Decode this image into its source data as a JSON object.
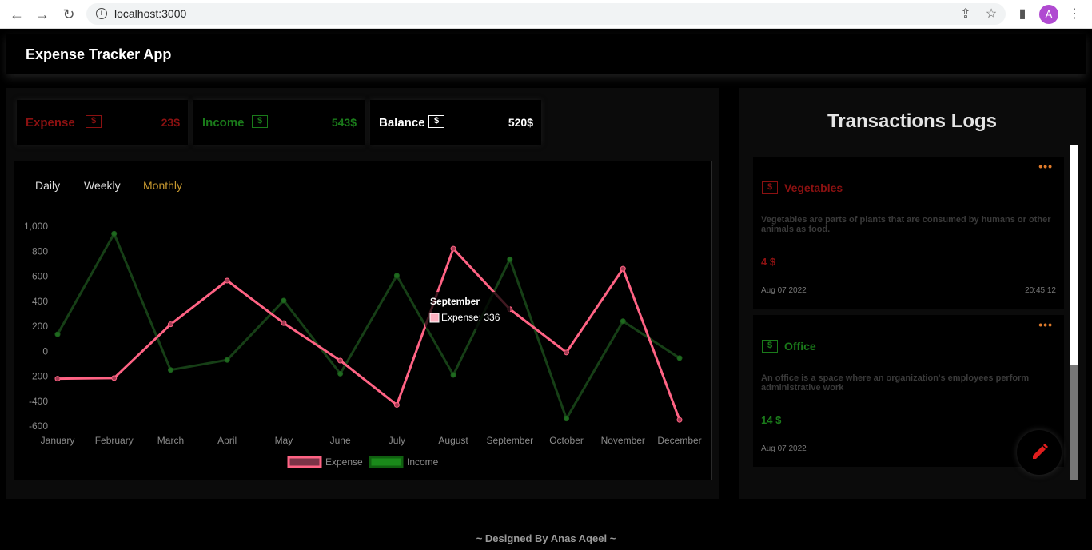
{
  "browser": {
    "url": "localhost:3000",
    "profile_initial": "A"
  },
  "app": {
    "title": "Expense Tracker App"
  },
  "stats": {
    "expense": {
      "label": "Expense",
      "value": "23$",
      "icon": "$"
    },
    "income": {
      "label": "Income",
      "value": "543$",
      "icon": "$"
    },
    "balance": {
      "label": "Balance",
      "value": "520$",
      "icon": "$"
    }
  },
  "tabs": {
    "daily": "Daily",
    "weekly": "Weekly",
    "monthly": "Monthly",
    "active": "monthly"
  },
  "chart_data": {
    "type": "line",
    "categories": [
      "January",
      "February",
      "March",
      "April",
      "May",
      "June",
      "July",
      "August",
      "September",
      "October",
      "November",
      "December"
    ],
    "series": [
      {
        "name": "Expense",
        "color": "#ff6384",
        "values": [
          -220,
          -215,
          215,
          565,
          225,
          -75,
          -430,
          820,
          336,
          -10,
          660,
          -550
        ]
      },
      {
        "name": "Income",
        "color": "#1f8a1f",
        "values": [
          135,
          940,
          -150,
          -70,
          405,
          -180,
          605,
          -190,
          735,
          -540,
          240,
          -55
        ]
      }
    ],
    "y_ticks": [
      "1,000",
      "800",
      "600",
      "400",
      "200",
      "0",
      "-200",
      "-400",
      "-600"
    ],
    "ylim": [
      -600,
      1000
    ],
    "legend_position": "bottom",
    "tooltip": {
      "title": "September",
      "label": "Expense: 336"
    }
  },
  "logs": {
    "title": "Transactions Logs",
    "items": [
      {
        "title": "Vegetables",
        "type": "expense",
        "description": "Vegetables are parts of plants that are consumed by humans or other animals as food.",
        "amount": "4 $",
        "date": "Aug 07 2022",
        "time": "20:45:12",
        "icon": "$"
      },
      {
        "title": "Office",
        "type": "income",
        "description": "An office is a space where an organization's employees perform administrative work",
        "amount": "14 $",
        "date": "Aug 07 2022",
        "time": "",
        "icon": "$"
      }
    ],
    "menu_dots": "•••"
  },
  "fab": {
    "icon": "pencil-icon",
    "color": "#e01e1e"
  },
  "footer": {
    "text": "~ Designed By Anas Aqeel ~"
  }
}
